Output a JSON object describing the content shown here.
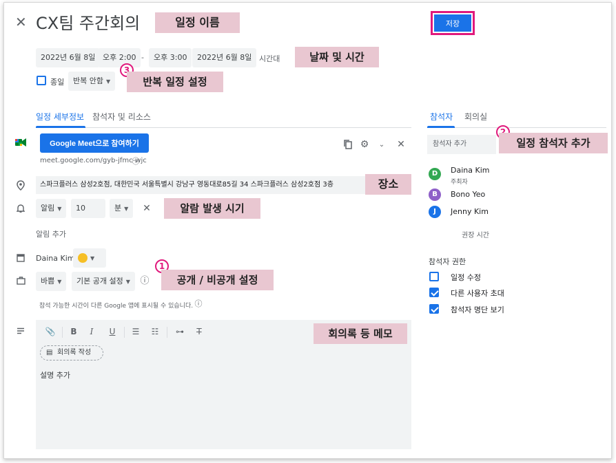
{
  "header": {
    "close_icon": "close-icon",
    "title": "CX팀 주간회의",
    "save_label": "저장"
  },
  "annotations": {
    "event_name": "일정 이름",
    "date_time": "날짜 및 시간",
    "repeat": "반복 일정 설정",
    "guests": "일정 참석자 추가",
    "location": "장소",
    "notification": "알람 발생 시기",
    "visibility": "공개 / 비공개 설정",
    "notes": "회의록 등 메모",
    "num1": "1",
    "num2": "2",
    "num3": "3"
  },
  "datetime": {
    "start_date": "2022년 6월 8일",
    "start_time": "오후 2:00",
    "separator": "-",
    "end_time": "오후 3:00",
    "end_date": "2022년 6월 8일",
    "timezone_label": "시간대",
    "allday_label": "종일",
    "repeat_value": "반복 안함"
  },
  "tabs": {
    "details": "일정 세부정보",
    "guests_resources": "참석자 및 리소스"
  },
  "meet": {
    "button_label": "Google Meet으로 참여하기",
    "link": "meet.google.com/gyb-jfmc-wjc"
  },
  "location": {
    "value": "스파크플러스 삼성2호점, 대한민국 서울특별시 강남구 영동대로85길 34 스파크플러스 삼성2호점 3층"
  },
  "notification": {
    "type": "알림",
    "amount": "10",
    "unit": "분",
    "add_label": "알림 추가"
  },
  "calendar": {
    "owner": "Daina Kim",
    "color": "#f6bf26"
  },
  "visibility": {
    "busy": "바쁨",
    "privacy": "기본 공개 설정",
    "note": "참석 가능한 시간이 다른 Google 앱에 표시될 수 있습니다."
  },
  "editor": {
    "minutes_label": "회의록 작성",
    "placeholder": "설명 추가"
  },
  "right": {
    "tab_guests": "참석자",
    "tab_rooms": "회의실",
    "guest_input_placeholder": "참석자 추가",
    "guests": [
      {
        "initial": "D",
        "name": "Daina Kim",
        "role": "주최자",
        "color": "#33a852"
      },
      {
        "initial": "B",
        "name": "Bono Yeo",
        "role": "",
        "color": "#8e5fc8"
      },
      {
        "initial": "J",
        "name": "Jenny Kim",
        "role": "",
        "color": "#1a73e8"
      }
    ],
    "suggested_time": "권장 시간",
    "permissions_title": "참석자 권한",
    "permissions": [
      {
        "label": "일정 수정",
        "checked": false
      },
      {
        "label": "다른 사용자 초대",
        "checked": true
      },
      {
        "label": "참석자 명단 보기",
        "checked": true
      }
    ]
  }
}
